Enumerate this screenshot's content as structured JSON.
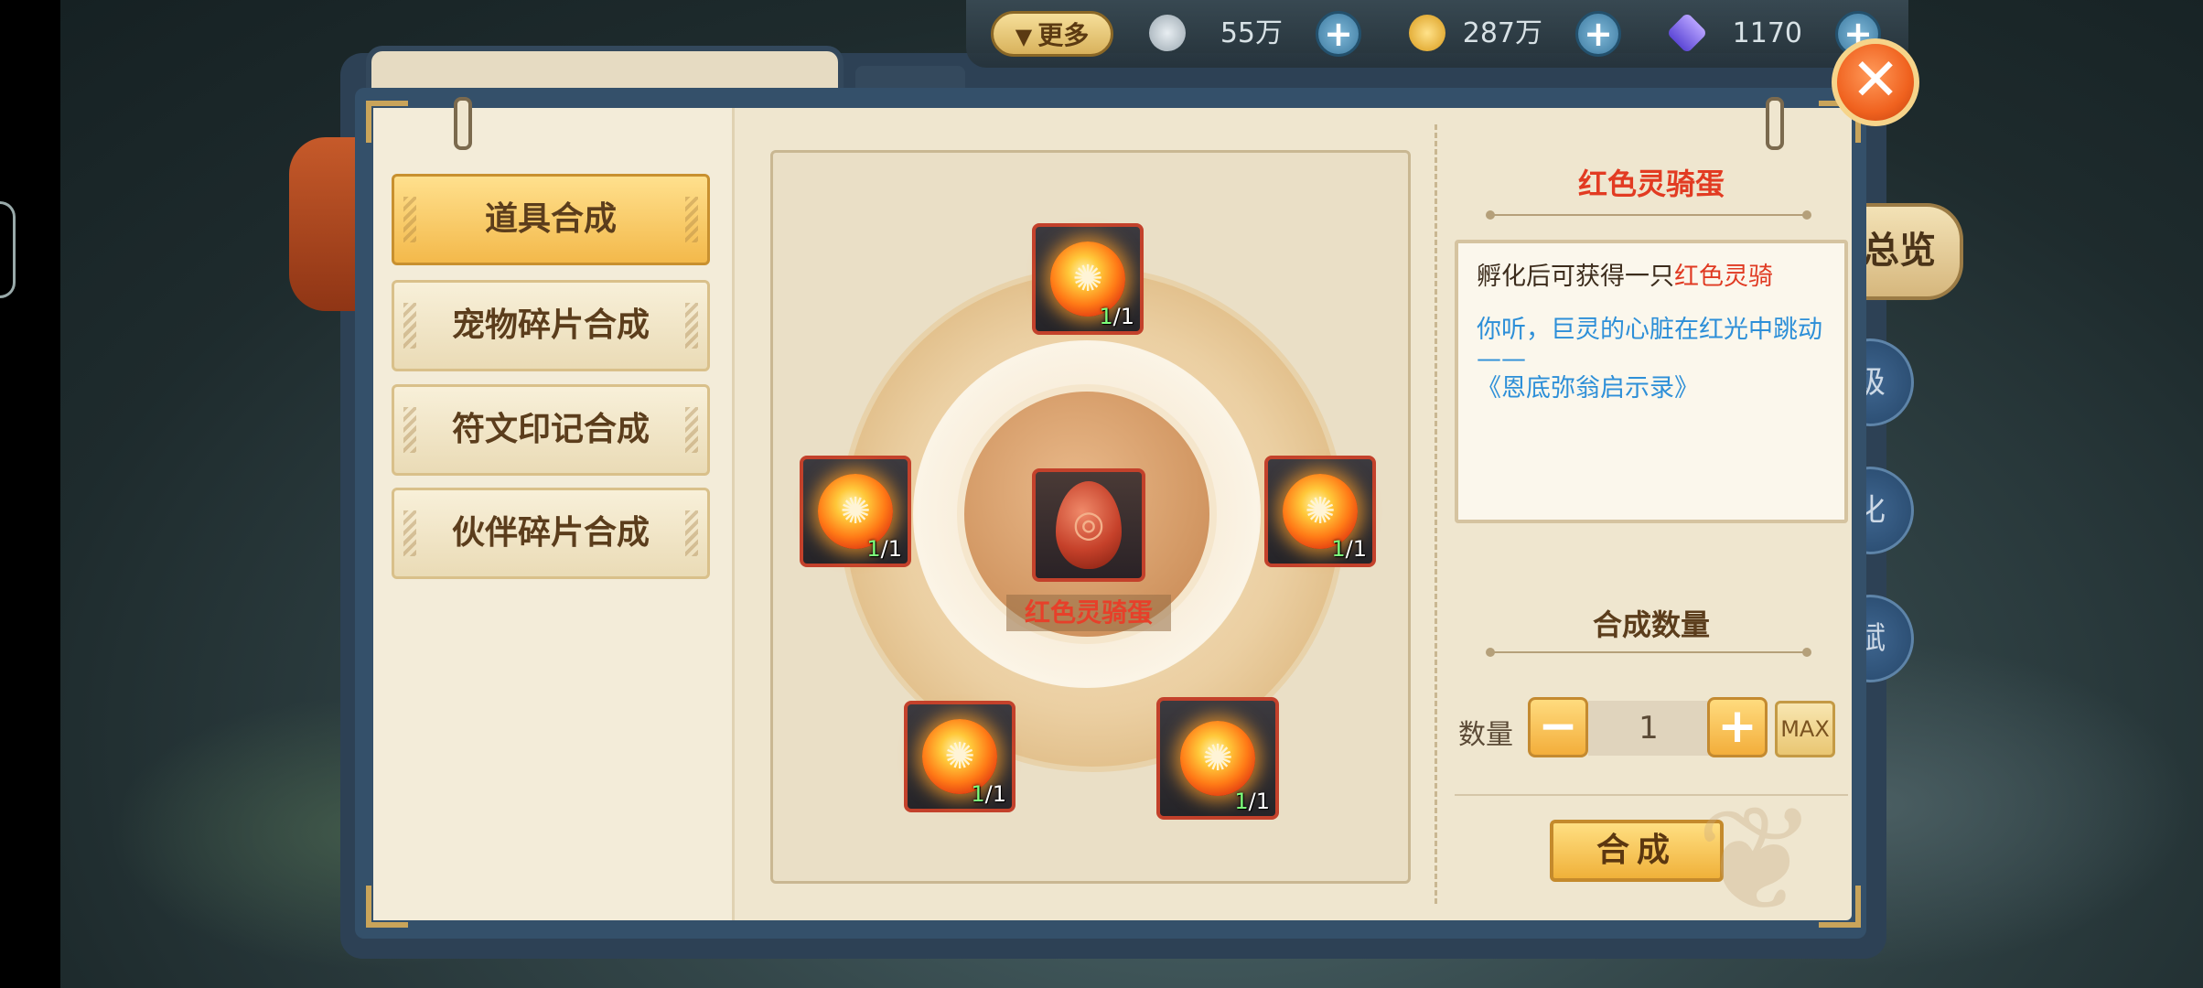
{
  "topbar": {
    "more_label": "更多",
    "currencies": [
      {
        "icon": "silver-leaf-icon",
        "value": "55万"
      },
      {
        "icon": "gold-leaf-icon",
        "value": "287万"
      },
      {
        "icon": "crystal-gem-icon",
        "value": "1170"
      }
    ],
    "plus_label": "+"
  },
  "menu": {
    "items": [
      {
        "label": "道具合成",
        "active": true
      },
      {
        "label": "宠物碎片合成",
        "active": false
      },
      {
        "label": "符文印记合成",
        "active": false
      },
      {
        "label": "伙伴碎片合成",
        "active": false
      }
    ]
  },
  "center": {
    "result_name": "红色灵骑蛋",
    "ingredients": [
      {
        "count_have": "1",
        "count_need": "/1"
      },
      {
        "count_have": "1",
        "count_need": "/1"
      },
      {
        "count_have": "1",
        "count_need": "/1"
      },
      {
        "count_have": "1",
        "count_need": "/1"
      },
      {
        "count_have": "1",
        "count_need": "/1"
      }
    ]
  },
  "detail": {
    "title": "红色灵骑蛋",
    "desc_prefix": "孵化后可获得一只",
    "desc_highlight": "红色灵骑",
    "quote_line1": "你听，巨灵的心脏在红光中跳动——",
    "quote_line2": "《恩底弥翁启示录》"
  },
  "quantity": {
    "title": "合成数量",
    "label": "数量",
    "minus": "−",
    "plus": "+",
    "value": "1",
    "max_label": "MAX"
  },
  "actions": {
    "merge_label": "合成",
    "close_label": "✕"
  },
  "background": {
    "right_button_overview": "总览",
    "right_buttons": [
      "级",
      "化",
      "赋"
    ]
  },
  "colors": {
    "accent_red": "#e23b22",
    "quote_blue": "#2d8fd8",
    "button_gold": "#f3b94b"
  }
}
